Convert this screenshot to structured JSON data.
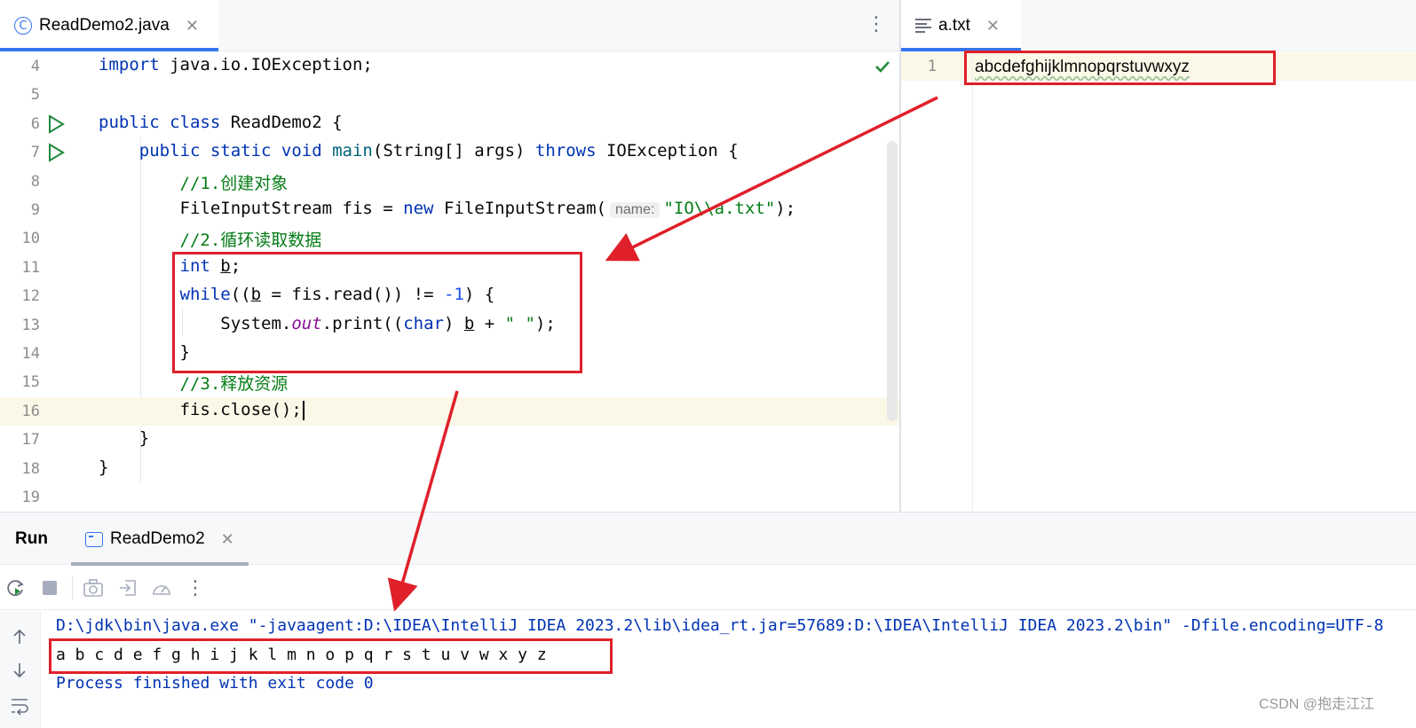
{
  "editor_tab": {
    "label": "ReadDemo2.java"
  },
  "text_tab": {
    "label": "a.txt"
  },
  "code_lines": [
    {
      "num": "4",
      "segments": [
        [
          "kw",
          "import"
        ],
        [
          "",
          "java.io.IOException;"
        ]
      ]
    },
    {
      "num": "5",
      "segments": []
    },
    {
      "num": "6",
      "segments": [
        [
          "kw",
          "public class"
        ],
        [
          "",
          "ReadDemo2 {"
        ]
      ]
    },
    {
      "num": "7",
      "segments": [
        [
          "",
          "    "
        ],
        [
          "kw",
          "public static void"
        ],
        [
          "fn",
          "main"
        ],
        [
          "",
          "(String[] args) "
        ],
        [
          "kw",
          "throws"
        ],
        [
          "",
          "IOException {"
        ]
      ]
    },
    {
      "num": "8",
      "segments": [
        [
          "",
          "        "
        ],
        [
          "cm",
          "//1.创建对象"
        ]
      ]
    },
    {
      "num": "9",
      "segments": [
        [
          "",
          "        FileInputStream fis = "
        ],
        [
          "kw",
          "new"
        ],
        [
          "",
          "FileInputStream("
        ],
        [
          "hint",
          "name:"
        ],
        [
          "st",
          "\"IO\\\\a.txt\""
        ],
        [
          "",
          ");"
        ]
      ]
    },
    {
      "num": "10",
      "segments": [
        [
          "",
          "        "
        ],
        [
          "cm",
          "//2.循环读取数据"
        ]
      ]
    },
    {
      "num": "11",
      "segments": [
        [
          "",
          "        "
        ],
        [
          "kw",
          "int"
        ],
        [
          "ul",
          "b"
        ],
        [
          "",
          ";"
        ]
      ]
    },
    {
      "num": "12",
      "segments": [
        [
          "",
          "        "
        ],
        [
          "kw",
          "while"
        ],
        [
          "",
          "(("
        ],
        [
          "ul",
          "b"
        ],
        [
          "",
          " = fis.read()) != "
        ],
        [
          "num",
          "-1"
        ],
        [
          "",
          ") {"
        ]
      ]
    },
    {
      "num": "13",
      "segments": [
        [
          "",
          "            System."
        ],
        [
          "stat",
          "out"
        ],
        [
          "",
          ".print(("
        ],
        [
          "kw",
          "char"
        ],
        [
          "",
          ") "
        ],
        [
          "ul",
          "b"
        ],
        [
          "",
          " + "
        ],
        [
          "st",
          "\" \""
        ],
        [
          "",
          ");"
        ]
      ]
    },
    {
      "num": "14",
      "segments": [
        [
          "",
          "        }"
        ]
      ]
    },
    {
      "num": "15",
      "segments": [
        [
          "",
          "        "
        ],
        [
          "cm",
          "//3.释放资源"
        ]
      ]
    },
    {
      "num": "16",
      "segments": [
        [
          "",
          "        fis.close();"
        ]
      ]
    },
    {
      "num": "17",
      "segments": [
        [
          "",
          "    }"
        ]
      ]
    },
    {
      "num": "18",
      "segments": [
        [
          "",
          "}"
        ]
      ]
    },
    {
      "num": "19",
      "segments": []
    }
  ],
  "text_file": {
    "line_number": "1",
    "content": "abcdefghijklmnopqrstuvwxyz"
  },
  "run_panel": {
    "title": "Run",
    "tab_label": "ReadDemo2",
    "command_line": "D:\\jdk\\bin\\java.exe \"-javaagent:D:\\IDEA\\IntelliJ IDEA 2023.2\\lib\\idea_rt.jar=57689:D:\\IDEA\\IntelliJ IDEA 2023.2\\bin\" -Dfile.encoding=UTF-8",
    "output": "a b c d e f g h i j k l m n o p q r s t u v w x y z",
    "exit_message": "Process finished with exit code 0"
  },
  "watermark": "CSDN @抱走江江",
  "colors": {
    "accent": "#3574f0",
    "annotation": "#e0202a",
    "keyword": "#0033b3",
    "comment": "#067d17"
  },
  "icons": {
    "java_tab": "class-c-icon",
    "txt_tab": "text-file-icon",
    "run_tab": "run-config-icon",
    "toolbar": [
      "rerun-icon",
      "stop-icon",
      "camera-icon",
      "import-icon",
      "profiler-icon",
      "more-icon"
    ],
    "gutter": [
      "arrow-up-icon",
      "arrow-down-icon",
      "soft-wrap-icon"
    ]
  }
}
